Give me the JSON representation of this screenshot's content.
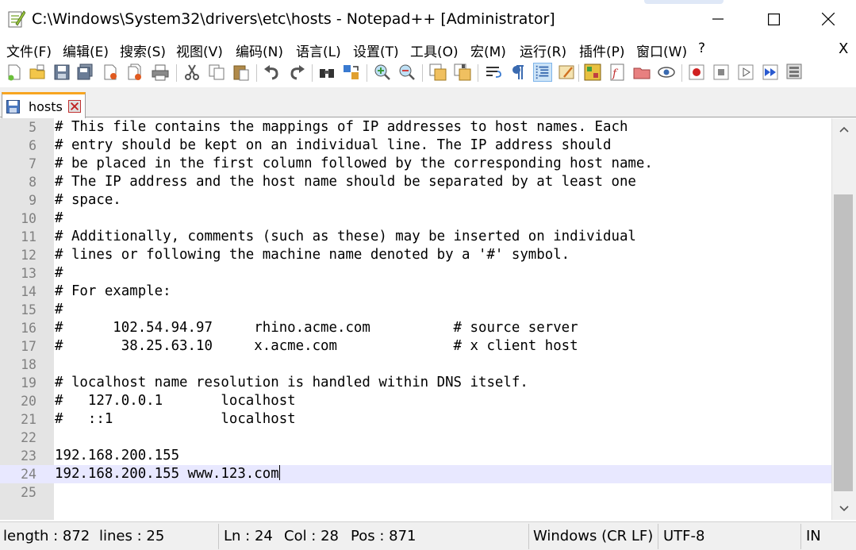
{
  "window": {
    "title": "C:\\Windows\\System32\\drivers\\etc\\hosts - Notepad++ [Administrator]",
    "app_icon": "notepadpp-icon",
    "controls": [
      "minimize-icon",
      "maximize-icon",
      "close-icon"
    ]
  },
  "menu": {
    "items": [
      "文件(F)",
      "编辑(E)",
      "搜索(S)",
      "视图(V)",
      "编码(N)",
      "语言(L)",
      "设置(T)",
      "工具(O)",
      "宏(M)",
      "运行(R)",
      "插件(P)",
      "窗口(W)",
      "?"
    ],
    "close_label": "X"
  },
  "toolbar": {
    "buttons": [
      "new-file-icon",
      "open-file-icon",
      "save-icon",
      "save-all-icon",
      "close-icon",
      "close-all-icon",
      "print-icon",
      "cut-icon",
      "copy-icon",
      "paste-icon",
      "undo-icon",
      "redo-icon",
      "find-icon",
      "replace-icon",
      "zoom-in-icon",
      "zoom-out-icon",
      "sync-vertical-icon",
      "sync-horizontal-icon",
      "word-wrap-icon",
      "show-all-chars-icon",
      "indent-guide-icon",
      "user-lang-icon",
      "doc-map-icon",
      "function-list-icon",
      "folder-workspace-icon",
      "monitor-icon",
      "record-macro-icon",
      "stop-record-icon",
      "play-macro-icon",
      "run-macro-multiple-icon",
      "save-macro-icon"
    ]
  },
  "tabs": [
    {
      "label": "hosts",
      "icon": "save-disk-icon",
      "close_icon": "tab-close-icon"
    }
  ],
  "editor": {
    "current_line": 24,
    "lines": [
      {
        "n": "5",
        "text": "# This file contains the mappings of IP addresses to host names. Each"
      },
      {
        "n": "6",
        "text": "# entry should be kept on an individual line. The IP address should"
      },
      {
        "n": "7",
        "text": "# be placed in the first column followed by the corresponding host name."
      },
      {
        "n": "8",
        "text": "# The IP address and the host name should be separated by at least one"
      },
      {
        "n": "9",
        "text": "# space."
      },
      {
        "n": "10",
        "text": "#"
      },
      {
        "n": "11",
        "text": "# Additionally, comments (such as these) may be inserted on individual"
      },
      {
        "n": "12",
        "text": "# lines or following the machine name denoted by a '#' symbol."
      },
      {
        "n": "13",
        "text": "#"
      },
      {
        "n": "14",
        "text": "# For example:"
      },
      {
        "n": "15",
        "text": "#"
      },
      {
        "n": "16",
        "text": "#      102.54.94.97     rhino.acme.com          # source server"
      },
      {
        "n": "17",
        "text": "#       38.25.63.10     x.acme.com              # x client host"
      },
      {
        "n": "18",
        "text": ""
      },
      {
        "n": "19",
        "text": "# localhost name resolution is handled within DNS itself."
      },
      {
        "n": "20",
        "text": "#   127.0.0.1       localhost"
      },
      {
        "n": "21",
        "text": "#   ::1             localhost"
      },
      {
        "n": "22",
        "text": ""
      },
      {
        "n": "23",
        "text": "192.168.200.155"
      },
      {
        "n": "24",
        "text": "192.168.200.155 www.123.com"
      },
      {
        "n": "25",
        "text": ""
      }
    ]
  },
  "status": {
    "length": "length : 872",
    "lines": "lines : 25",
    "ln": "Ln : 24",
    "col": "Col : 28",
    "pos": "Pos : 871",
    "eol": "Windows (CR LF)",
    "encoding": "UTF-8",
    "mode": "IN"
  }
}
